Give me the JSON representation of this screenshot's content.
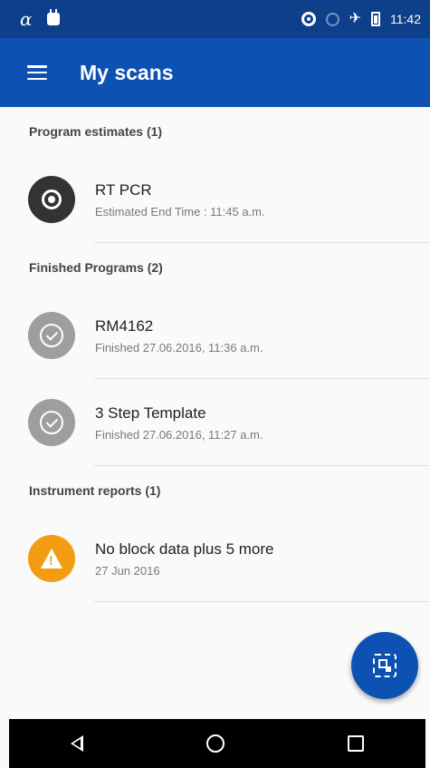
{
  "status_bar": {
    "time": "11:42",
    "alpha_glyph": "α"
  },
  "app_bar": {
    "title": "My scans"
  },
  "sections": [
    {
      "header": "Program estimates (1)",
      "items": [
        {
          "title": "RT PCR",
          "subtitle": "Estimated End Time : 11:45 a.m.",
          "icon": "clock-icon"
        }
      ]
    },
    {
      "header": "Finished Programs (2)",
      "items": [
        {
          "title": "RM4162",
          "subtitle": "Finished 27.06.2016, 11:36 a.m.",
          "icon": "check-circle-icon"
        },
        {
          "title": "3 Step Template",
          "subtitle": "Finished 27.06.2016, 11:27 a.m.",
          "icon": "check-circle-icon"
        }
      ]
    },
    {
      "header": "Instrument reports (1)",
      "items": [
        {
          "title": "No block data plus 5 more",
          "subtitle": "27 Jun 2016",
          "icon": "warning-icon"
        }
      ]
    }
  ],
  "fab": {
    "icon": "qr-scan-icon"
  },
  "colors": {
    "status_bar": "#0d3f8a",
    "app_bar": "#0d52b3",
    "warning": "#f39c12",
    "finished": "#9e9e9e",
    "running": "#333333"
  }
}
